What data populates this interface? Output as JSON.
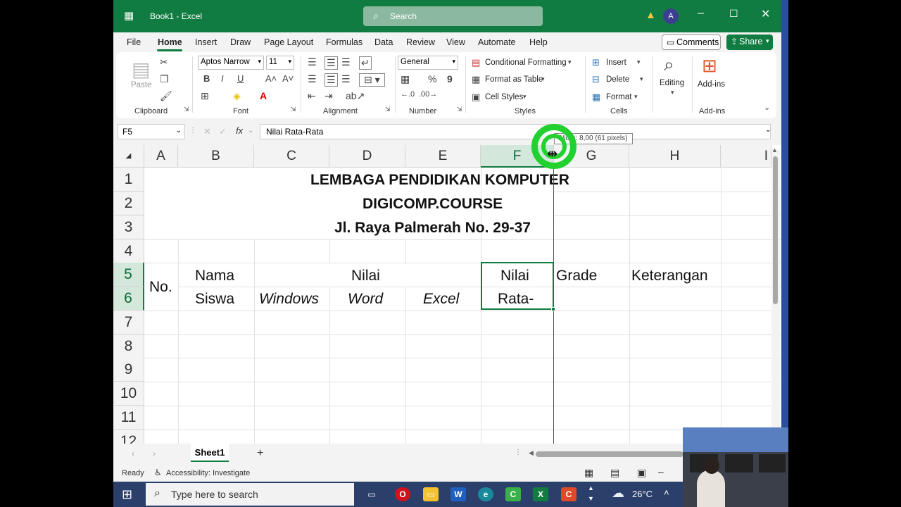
{
  "app": {
    "title": "Book1  -  Excel",
    "search_placeholder": "Search",
    "avatar_initial": "A"
  },
  "ribbon_tabs": [
    "File",
    "Home",
    "Insert",
    "Draw",
    "Page Layout",
    "Formulas",
    "Data",
    "Review",
    "View",
    "Automate",
    "Help"
  ],
  "active_tab": "Home",
  "comments_label": "Comments",
  "share_label": "Share",
  "ribbon": {
    "paste": "Paste",
    "font_name": "Aptos Narrow",
    "font_size": "11",
    "number_format": "General",
    "conditional_formatting": "Conditional Formatting",
    "format_as_table": "Format as Table",
    "cell_styles": "Cell Styles",
    "insert": "Insert",
    "delete": "Delete",
    "format": "Format",
    "editing": "Editing",
    "addins": "Add-ins",
    "groups": [
      "Clipboard",
      "Font",
      "Alignment",
      "Number",
      "Styles",
      "Cells",
      "Add-ins"
    ]
  },
  "formula_bar": {
    "name_box": "F5",
    "fx": "fx",
    "content": "Nilai Rata-Rata"
  },
  "tooltip": "Width: 8,00 (61 pixels)",
  "columns": [
    "A",
    "B",
    "C",
    "D",
    "E",
    "F",
    "G",
    "H",
    "I"
  ],
  "rows": [
    "1",
    "2",
    "3",
    "4",
    "5",
    "6",
    "7",
    "8",
    "9",
    "10",
    "11",
    "12"
  ],
  "selected_cell": "F5",
  "cells": {
    "title1": "LEMBAGA PENDIDIKAN KOMPUTER",
    "title2": "DIGICOMP.COURSE",
    "title3": "Jl. Raya Palmerah No. 29-37",
    "no": "No.",
    "nama": "Nama",
    "siswa": "Siswa",
    "nilai": "Nilai",
    "windows": "Windows",
    "word": "Word",
    "excel": "Excel",
    "nilai_rata_top": "Nilai",
    "nilai_rata_bottom": "Rata-",
    "grade": "Grade",
    "keterangan": "Keterangan"
  },
  "sheet_tab": "Sheet1",
  "status": {
    "ready": "Ready",
    "accessibility": "Accessibility: Investigate"
  },
  "taskbar": {
    "search_placeholder": "Type here to search",
    "weather": "26°C"
  }
}
